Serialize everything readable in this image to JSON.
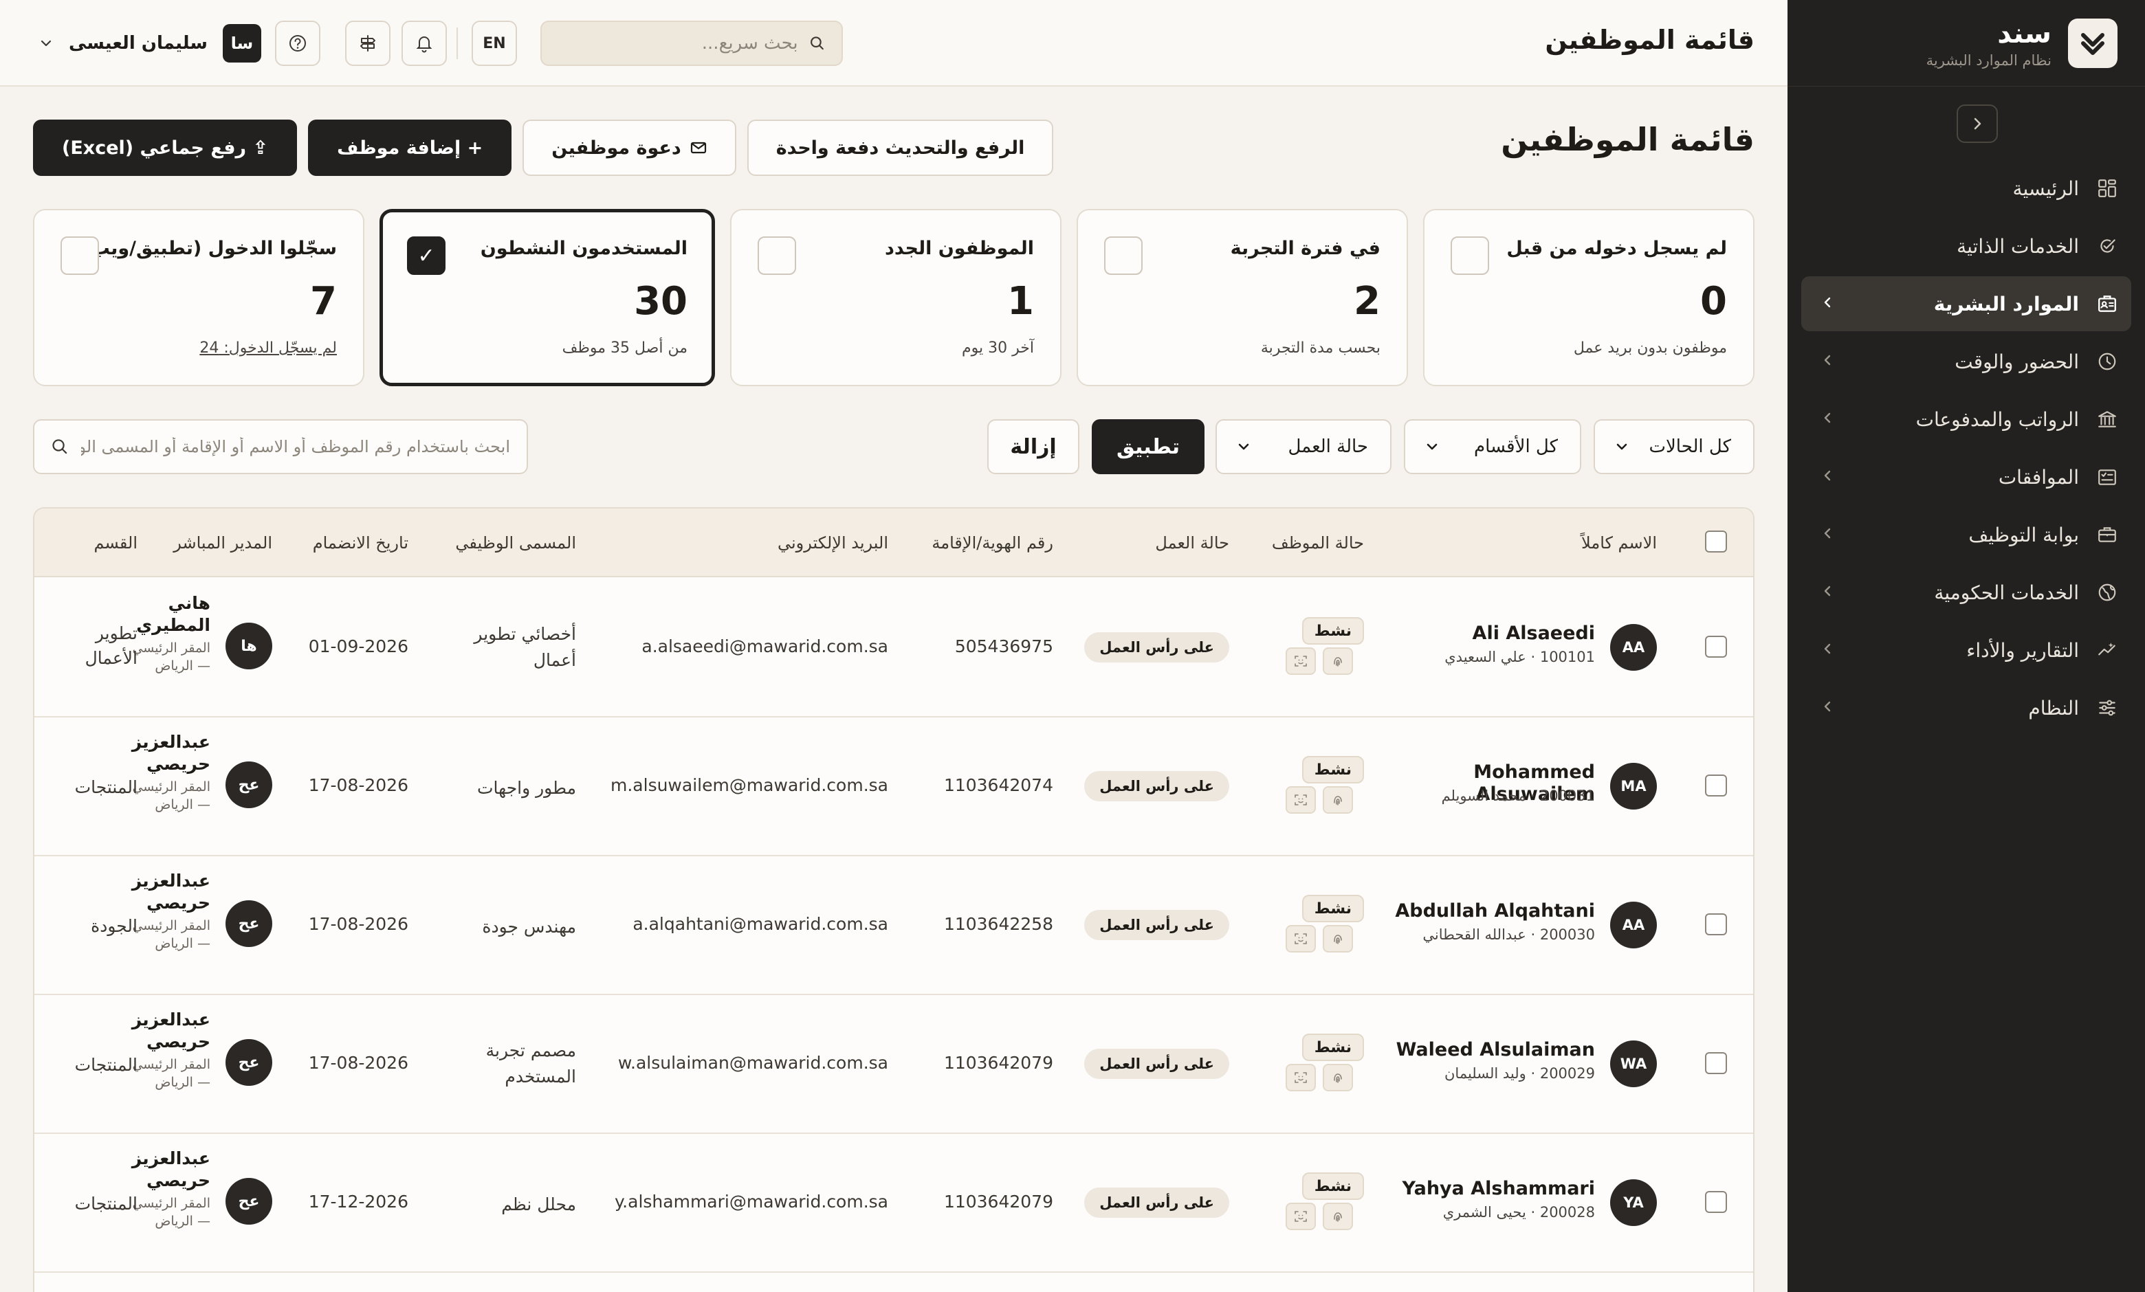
{
  "brand": {
    "name": "سند",
    "subtitle": "نظام الموارد البشرية"
  },
  "sidebar": {
    "items": [
      {
        "label": "الرئيسية",
        "icon": "dashboard-icon",
        "active": false,
        "has_children": false
      },
      {
        "label": "الخدمات الذاتية",
        "icon": "self-service-icon",
        "active": false,
        "has_children": false
      },
      {
        "label": "الموارد البشرية",
        "icon": "hr-badge-icon",
        "active": true,
        "has_children": true
      },
      {
        "label": "الحضور والوقت",
        "icon": "clock-icon",
        "active": false,
        "has_children": true
      },
      {
        "label": "الرواتب والمدفوعات",
        "icon": "bank-icon",
        "active": false,
        "has_children": true
      },
      {
        "label": "الموافقات",
        "icon": "approvals-icon",
        "active": false,
        "has_children": true
      },
      {
        "label": "بوابة التوظيف",
        "icon": "briefcase-icon",
        "active": false,
        "has_children": true
      },
      {
        "label": "الخدمات الحكومية",
        "icon": "globe-icon",
        "active": false,
        "has_children": true
      },
      {
        "label": "التقارير والأداء",
        "icon": "analytics-icon",
        "active": false,
        "has_children": true
      },
      {
        "label": "النظام",
        "icon": "sliders-icon",
        "active": false,
        "has_children": true
      }
    ]
  },
  "topbar": {
    "title": "قائمة الموظفين",
    "search_placeholder": "بحث سريع...",
    "lang_label": "EN",
    "user": {
      "initials": "سا",
      "name": "سليمان العيسى"
    }
  },
  "page": {
    "title": "قائمة الموظفين",
    "actions": {
      "batch_upload": "الرفع والتحديث دفعة واحدة",
      "invite": "دعوة موظفين",
      "add": "+ إضافة موظف",
      "excel": "⇪ رفع جماعي (Excel)"
    }
  },
  "stats": [
    {
      "label": "لم يسجل دخوله من قبل",
      "value": "0",
      "sub": "موظفون بدون بريد عمل",
      "selected": false,
      "link": false
    },
    {
      "label": "في فترة التجربة",
      "value": "2",
      "sub": "بحسب مدة التجربة",
      "selected": false,
      "link": false
    },
    {
      "label": "الموظفون الجدد",
      "value": "1",
      "sub": "آخر 30 يوم",
      "selected": false,
      "link": false
    },
    {
      "label": "المستخدمون النشطون",
      "value": "30",
      "sub": "من أصل 35 موظف",
      "selected": true,
      "link": false
    },
    {
      "label": "سجّلوا الدخول (تطبيق/ويب)",
      "value": "7",
      "sub": "لم يسجّل الدخول: 24",
      "selected": false,
      "link": true
    }
  ],
  "filters": {
    "status": "كل الحالات",
    "department": "كل الأقسام",
    "work_status": "حالة العمل",
    "apply": "تطبيق",
    "clear": "إزالة",
    "search_placeholder": "ابحث باستخدام رقم الموظف أو الاسم أو الإقامة أو المسمى الوظيفي"
  },
  "table": {
    "columns": {
      "full_name": "الاسم كاملاً",
      "emp_status": "حالة الموظف",
      "work_status": "حالة العمل",
      "id_number": "رقم الهوية/الإقامة",
      "email": "البريد الإلكتروني",
      "job_title": "المسمى الوظيفي",
      "join_date": "تاريخ الانضمام",
      "manager": "المدير المباشر",
      "department": "القسم"
    },
    "rows": [
      {
        "initials": "AA",
        "name": "Ali Alsaeedi",
        "sub": "100101 · علي السعيدي",
        "status": "نشط",
        "work": "على رأس العمل",
        "id": "505436975",
        "email": "a.alsaeedi@mawarid.com.sa",
        "title": "أخصائي تطوير أعمال",
        "date": "01-09-2026",
        "mgr_initials": "ها",
        "mgr_name": "هاني المطيري",
        "mgr_loc": "المقر الرئيسي — الرياض",
        "dept": "تطوير الأعمال"
      },
      {
        "initials": "MA",
        "name": "Mohammed Alsuwailem",
        "sub": "200031 · محمد السويلم",
        "status": "نشط",
        "work": "على رأس العمل",
        "id": "1103642074",
        "email": "m.alsuwailem@mawarid.com.sa",
        "title": "مطور واجهات",
        "date": "17-08-2026",
        "mgr_initials": "عح",
        "mgr_name": "عبدالعزيز حريصي",
        "mgr_loc": "المقر الرئيسي — الرياض",
        "dept": "المنتجات"
      },
      {
        "initials": "AA",
        "name": "Abdullah Alqahtani",
        "sub": "200030 · عبدالله القحطاني",
        "status": "نشط",
        "work": "على رأس العمل",
        "id": "1103642258",
        "email": "a.alqahtani@mawarid.com.sa",
        "title": "مهندس جودة",
        "date": "17-08-2026",
        "mgr_initials": "عح",
        "mgr_name": "عبدالعزيز حريصي",
        "mgr_loc": "المقر الرئيسي — الرياض",
        "dept": "الجودة"
      },
      {
        "initials": "WA",
        "name": "Waleed Alsulaiman",
        "sub": "200029 · وليد السليمان",
        "status": "نشط",
        "work": "على رأس العمل",
        "id": "1103642079",
        "email": "w.alsulaiman@mawarid.com.sa",
        "title": "مصمم تجربة المستخدم",
        "date": "17-08-2026",
        "mgr_initials": "عح",
        "mgr_name": "عبدالعزيز حريصي",
        "mgr_loc": "المقر الرئيسي — الرياض",
        "dept": "المنتجات"
      },
      {
        "initials": "YA",
        "name": "Yahya Alshammari",
        "sub": "200028 · يحيى الشمري",
        "status": "نشط",
        "work": "على رأس العمل",
        "id": "1103642079",
        "email": "y.alshammari@mawarid.com.sa",
        "title": "محلل نظم",
        "date": "17-12-2026",
        "mgr_initials": "عح",
        "mgr_name": "عبدالعزيز حريصي",
        "mgr_loc": "المقر الرئيسي — الرياض",
        "dept": "المنتجات"
      }
    ]
  }
}
